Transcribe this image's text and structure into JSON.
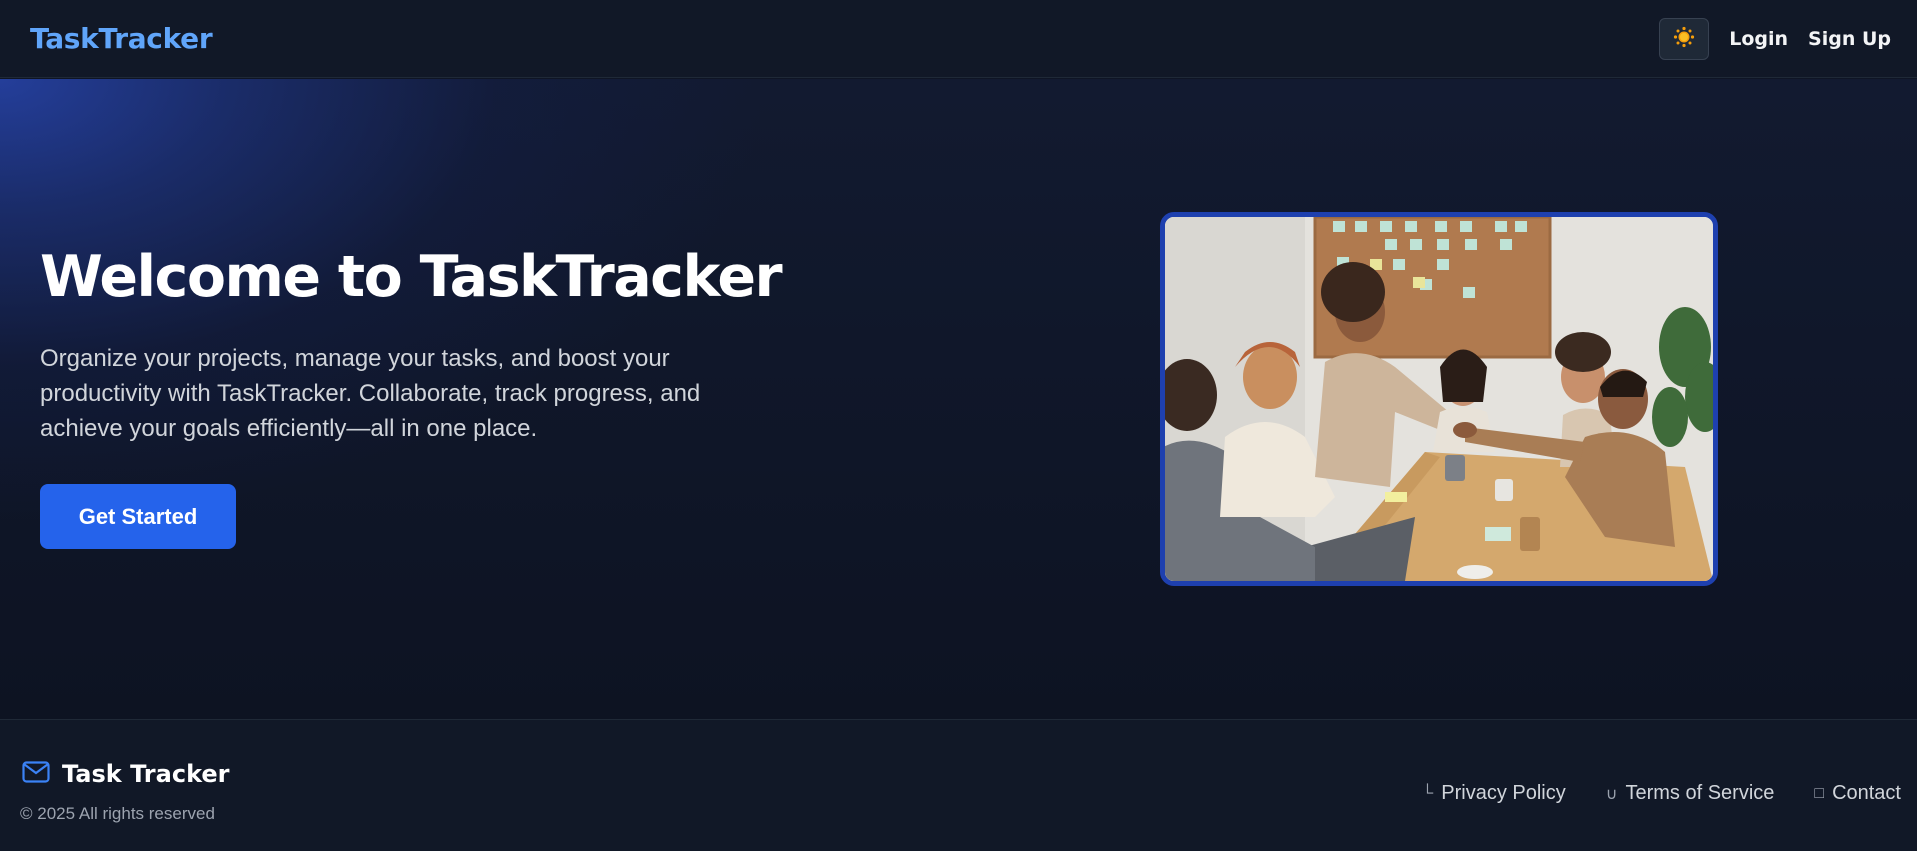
{
  "navbar": {
    "brand": "TaskTracker",
    "theme_icon": "sun-icon",
    "login_label": "Login",
    "signup_label": "Sign Up"
  },
  "hero": {
    "title": "Welcome to TaskTracker",
    "description": "Organize your projects, manage your tasks, and boost your productivity with TaskTracker. Collaborate, track progress, and achieve your goals efficiently—all in one place.",
    "cta_label": "Get Started",
    "image_alt": "Team meeting around a table"
  },
  "footer": {
    "brand_icon": "mail-icon",
    "title": "Task Tracker",
    "copyright": "© 2025 All rights reserved",
    "links": [
      {
        "label": "Privacy Policy",
        "icon": "shield-icon"
      },
      {
        "label": "Terms of Service",
        "icon": "file-icon"
      },
      {
        "label": "Contact",
        "icon": "phone-icon"
      }
    ]
  },
  "colors": {
    "accent": "#2563eb",
    "brand": "#60a5fa",
    "image_border": "#1e40af",
    "background": "#0f1525"
  }
}
